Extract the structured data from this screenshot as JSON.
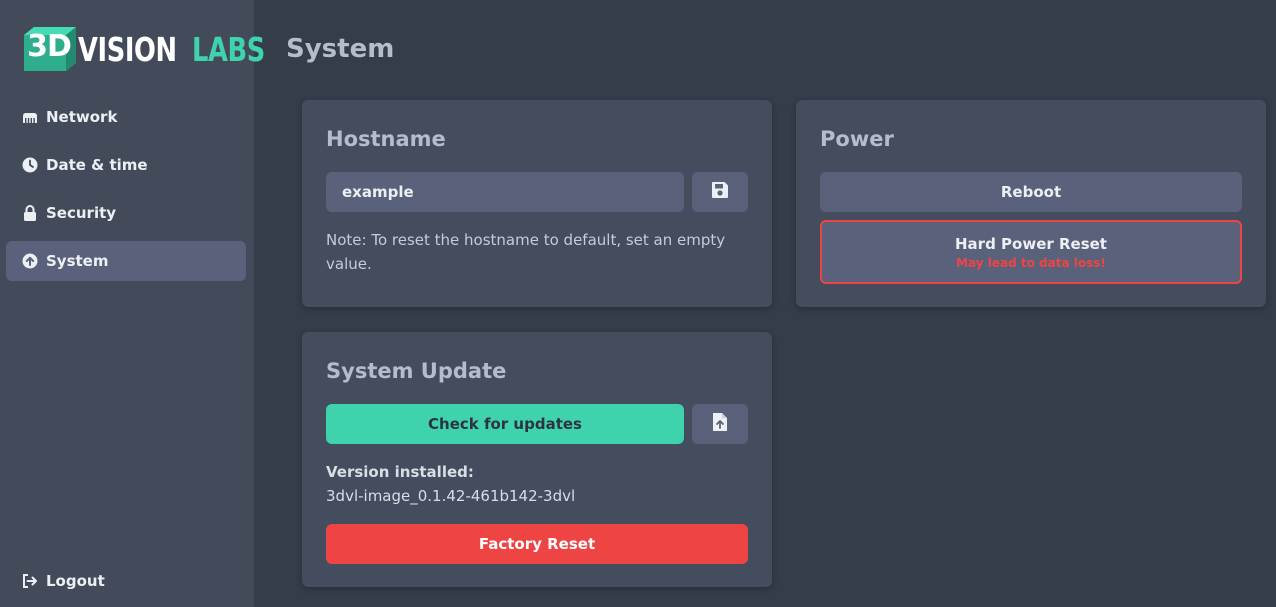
{
  "brand": {
    "mark_text": "3D",
    "name_part1": "VISION",
    "name_part2": "LABS",
    "accent_color": "#3ed3ac"
  },
  "sidebar": {
    "items": [
      {
        "label": "Network",
        "icon": "network-icon",
        "active": false
      },
      {
        "label": "Date & time",
        "icon": "clock-icon",
        "active": false
      },
      {
        "label": "Security",
        "icon": "lock-icon",
        "active": false
      },
      {
        "label": "System",
        "icon": "upload-circle-icon",
        "active": true
      }
    ],
    "logout_label": "Logout"
  },
  "page": {
    "title": "System"
  },
  "hostname": {
    "title": "Hostname",
    "value": "example",
    "note": "Note: To reset the hostname to default, set an empty value.",
    "save_icon": "save-icon"
  },
  "power": {
    "title": "Power",
    "reboot_label": "Reboot",
    "hard_reset_label": "Hard Power Reset",
    "hard_reset_warning": "May lead to data loss!"
  },
  "update": {
    "title": "System Update",
    "check_label": "Check for updates",
    "upload_icon": "file-upload-icon",
    "version_label": "Version installed:",
    "version_value": "3dvl-image_0.1.42-461b142-3dvl",
    "factory_reset_label": "Factory Reset"
  },
  "colors": {
    "background": "#353c4a",
    "sidebar": "#434b5b",
    "card": "#444d5d",
    "control": "#59627a",
    "danger": "#ef4444",
    "success": "#3ed3ac"
  }
}
